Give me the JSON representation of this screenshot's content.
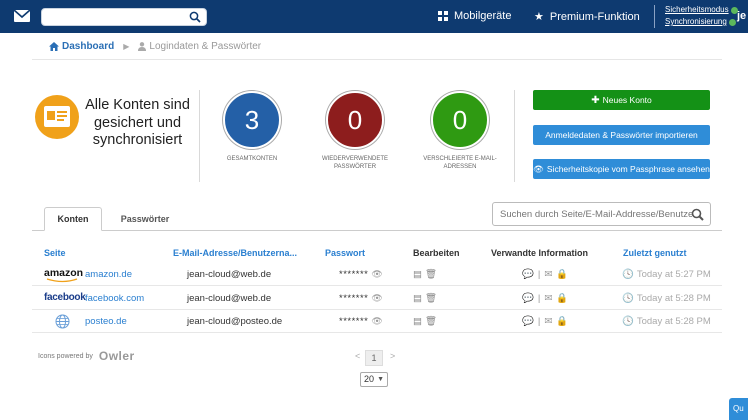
{
  "topbar": {
    "search_placeholder": "",
    "nav_mobile": "Mobilgeräte",
    "nav_premium": "Premium-Funktion",
    "status_security": "Sicherheitsmodus",
    "status_sync": "Synchronisierung",
    "user_initial": "je"
  },
  "breadcrumb": {
    "home": "Dashboard",
    "current": "Logindaten & Passwörter"
  },
  "summary": {
    "headline": "Alle Konten sind gesichert und synchronisiert",
    "stats": [
      {
        "value": "3",
        "label": "GESAMTKONTEN",
        "color": "#2460a7"
      },
      {
        "value": "0",
        "label": "WIEDERVERWENDETE PASSWÖRTER",
        "color": "#8d1d1d"
      },
      {
        "value": "0",
        "label": "VERSCHLEIERTE E-MAIL-ADRESSEN",
        "color": "#2f9a12"
      }
    ]
  },
  "actions": {
    "new_account": "Neues Konto",
    "import": "Anmeldedaten & Passwörter importieren",
    "backup": "Sicherheitskopie vom Passphrase ansehen"
  },
  "tabs": {
    "accounts": "Konten",
    "passwords": "Passwörter",
    "search_placeholder": "Suchen durch Seite/E-Mail-Addresse/Benutzername"
  },
  "table": {
    "headers": {
      "site": "Seite",
      "email": "E-Mail-Adresse/Benutzerna...",
      "password": "Passwort",
      "edit": "Bearbeiten",
      "related": "Verwandte Information",
      "last_used": "Zuletzt genutzt"
    },
    "rows": [
      {
        "logo": "amazon",
        "site": "amazon.de",
        "email": "jean-cloud@web.de",
        "password": "*******",
        "last_used": "Today at 5:27 PM"
      },
      {
        "logo": "facebook",
        "site": "facebook.com",
        "email": "jean-cloud@web.de",
        "password": "*******",
        "last_used": "Today at 5:28 PM"
      },
      {
        "logo": "",
        "site": "posteo.de",
        "email": "jean-cloud@posteo.de",
        "password": "*******",
        "last_used": "Today at 5:28 PM"
      }
    ],
    "separator": "|"
  },
  "footer": {
    "powered_by": "Icons powered by",
    "brand": "Owler",
    "prev": "<",
    "page": "1",
    "next": ">",
    "per_page": "20",
    "corner_label": "Qu"
  },
  "colors": {
    "topbar": "#0e3a70",
    "accent_blue": "#2a7fd0",
    "new_button": "#149116",
    "info_button": "#2f8dd8",
    "badge_orange": "#f0a11a"
  }
}
